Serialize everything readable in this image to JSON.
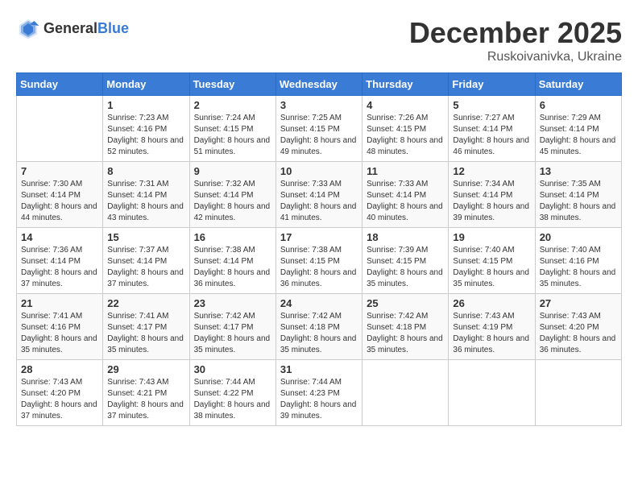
{
  "logo": {
    "general": "General",
    "blue": "Blue"
  },
  "title": "December 2025",
  "location": "Ruskoivanivka, Ukraine",
  "weekdays": [
    "Sunday",
    "Monday",
    "Tuesday",
    "Wednesday",
    "Thursday",
    "Friday",
    "Saturday"
  ],
  "weeks": [
    [
      {
        "day": "",
        "sunrise": "",
        "sunset": "",
        "daylight": ""
      },
      {
        "day": "1",
        "sunrise": "Sunrise: 7:23 AM",
        "sunset": "Sunset: 4:16 PM",
        "daylight": "Daylight: 8 hours and 52 minutes."
      },
      {
        "day": "2",
        "sunrise": "Sunrise: 7:24 AM",
        "sunset": "Sunset: 4:15 PM",
        "daylight": "Daylight: 8 hours and 51 minutes."
      },
      {
        "day": "3",
        "sunrise": "Sunrise: 7:25 AM",
        "sunset": "Sunset: 4:15 PM",
        "daylight": "Daylight: 8 hours and 49 minutes."
      },
      {
        "day": "4",
        "sunrise": "Sunrise: 7:26 AM",
        "sunset": "Sunset: 4:15 PM",
        "daylight": "Daylight: 8 hours and 48 minutes."
      },
      {
        "day": "5",
        "sunrise": "Sunrise: 7:27 AM",
        "sunset": "Sunset: 4:14 PM",
        "daylight": "Daylight: 8 hours and 46 minutes."
      },
      {
        "day": "6",
        "sunrise": "Sunrise: 7:29 AM",
        "sunset": "Sunset: 4:14 PM",
        "daylight": "Daylight: 8 hours and 45 minutes."
      }
    ],
    [
      {
        "day": "7",
        "sunrise": "Sunrise: 7:30 AM",
        "sunset": "Sunset: 4:14 PM",
        "daylight": "Daylight: 8 hours and 44 minutes."
      },
      {
        "day": "8",
        "sunrise": "Sunrise: 7:31 AM",
        "sunset": "Sunset: 4:14 PM",
        "daylight": "Daylight: 8 hours and 43 minutes."
      },
      {
        "day": "9",
        "sunrise": "Sunrise: 7:32 AM",
        "sunset": "Sunset: 4:14 PM",
        "daylight": "Daylight: 8 hours and 42 minutes."
      },
      {
        "day": "10",
        "sunrise": "Sunrise: 7:33 AM",
        "sunset": "Sunset: 4:14 PM",
        "daylight": "Daylight: 8 hours and 41 minutes."
      },
      {
        "day": "11",
        "sunrise": "Sunrise: 7:33 AM",
        "sunset": "Sunset: 4:14 PM",
        "daylight": "Daylight: 8 hours and 40 minutes."
      },
      {
        "day": "12",
        "sunrise": "Sunrise: 7:34 AM",
        "sunset": "Sunset: 4:14 PM",
        "daylight": "Daylight: 8 hours and 39 minutes."
      },
      {
        "day": "13",
        "sunrise": "Sunrise: 7:35 AM",
        "sunset": "Sunset: 4:14 PM",
        "daylight": "Daylight: 8 hours and 38 minutes."
      }
    ],
    [
      {
        "day": "14",
        "sunrise": "Sunrise: 7:36 AM",
        "sunset": "Sunset: 4:14 PM",
        "daylight": "Daylight: 8 hours and 37 minutes."
      },
      {
        "day": "15",
        "sunrise": "Sunrise: 7:37 AM",
        "sunset": "Sunset: 4:14 PM",
        "daylight": "Daylight: 8 hours and 37 minutes."
      },
      {
        "day": "16",
        "sunrise": "Sunrise: 7:38 AM",
        "sunset": "Sunset: 4:14 PM",
        "daylight": "Daylight: 8 hours and 36 minutes."
      },
      {
        "day": "17",
        "sunrise": "Sunrise: 7:38 AM",
        "sunset": "Sunset: 4:15 PM",
        "daylight": "Daylight: 8 hours and 36 minutes."
      },
      {
        "day": "18",
        "sunrise": "Sunrise: 7:39 AM",
        "sunset": "Sunset: 4:15 PM",
        "daylight": "Daylight: 8 hours and 35 minutes."
      },
      {
        "day": "19",
        "sunrise": "Sunrise: 7:40 AM",
        "sunset": "Sunset: 4:15 PM",
        "daylight": "Daylight: 8 hours and 35 minutes."
      },
      {
        "day": "20",
        "sunrise": "Sunrise: 7:40 AM",
        "sunset": "Sunset: 4:16 PM",
        "daylight": "Daylight: 8 hours and 35 minutes."
      }
    ],
    [
      {
        "day": "21",
        "sunrise": "Sunrise: 7:41 AM",
        "sunset": "Sunset: 4:16 PM",
        "daylight": "Daylight: 8 hours and 35 minutes."
      },
      {
        "day": "22",
        "sunrise": "Sunrise: 7:41 AM",
        "sunset": "Sunset: 4:17 PM",
        "daylight": "Daylight: 8 hours and 35 minutes."
      },
      {
        "day": "23",
        "sunrise": "Sunrise: 7:42 AM",
        "sunset": "Sunset: 4:17 PM",
        "daylight": "Daylight: 8 hours and 35 minutes."
      },
      {
        "day": "24",
        "sunrise": "Sunrise: 7:42 AM",
        "sunset": "Sunset: 4:18 PM",
        "daylight": "Daylight: 8 hours and 35 minutes."
      },
      {
        "day": "25",
        "sunrise": "Sunrise: 7:42 AM",
        "sunset": "Sunset: 4:18 PM",
        "daylight": "Daylight: 8 hours and 35 minutes."
      },
      {
        "day": "26",
        "sunrise": "Sunrise: 7:43 AM",
        "sunset": "Sunset: 4:19 PM",
        "daylight": "Daylight: 8 hours and 36 minutes."
      },
      {
        "day": "27",
        "sunrise": "Sunrise: 7:43 AM",
        "sunset": "Sunset: 4:20 PM",
        "daylight": "Daylight: 8 hours and 36 minutes."
      }
    ],
    [
      {
        "day": "28",
        "sunrise": "Sunrise: 7:43 AM",
        "sunset": "Sunset: 4:20 PM",
        "daylight": "Daylight: 8 hours and 37 minutes."
      },
      {
        "day": "29",
        "sunrise": "Sunrise: 7:43 AM",
        "sunset": "Sunset: 4:21 PM",
        "daylight": "Daylight: 8 hours and 37 minutes."
      },
      {
        "day": "30",
        "sunrise": "Sunrise: 7:44 AM",
        "sunset": "Sunset: 4:22 PM",
        "daylight": "Daylight: 8 hours and 38 minutes."
      },
      {
        "day": "31",
        "sunrise": "Sunrise: 7:44 AM",
        "sunset": "Sunset: 4:23 PM",
        "daylight": "Daylight: 8 hours and 39 minutes."
      },
      {
        "day": "",
        "sunrise": "",
        "sunset": "",
        "daylight": ""
      },
      {
        "day": "",
        "sunrise": "",
        "sunset": "",
        "daylight": ""
      },
      {
        "day": "",
        "sunrise": "",
        "sunset": "",
        "daylight": ""
      }
    ]
  ]
}
